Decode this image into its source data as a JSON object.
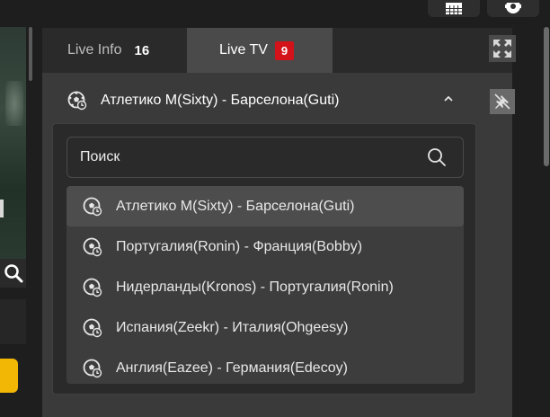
{
  "toolbar": {
    "calendar_icon": "calendar-grid-icon",
    "settings_icon": "gear-icon"
  },
  "tabs": {
    "live_info": {
      "label": "Live Info",
      "count": "16"
    },
    "live_tv": {
      "label": "Live TV",
      "count": "9"
    }
  },
  "current_match": {
    "title": "Атлетико М(Sixty) - Барселона(Guti)",
    "icon": "soccer-ball-icon"
  },
  "search": {
    "placeholder": "Поиск"
  },
  "matches": [
    {
      "label": "Атлетико М(Sixty) - Барселона(Guti)",
      "selected": true
    },
    {
      "label": "Португалия(Ronin) - Франция(Bobby)",
      "selected": false
    },
    {
      "label": "Нидерланды(Kronos) - Португалия(Ronin)",
      "selected": false
    },
    {
      "label": "Испания(Zeekr) - Италия(Ohgeesy)",
      "selected": false
    },
    {
      "label": "Англия(Eazee) - Германия(Edecoy)",
      "selected": false
    }
  ],
  "colors": {
    "badge_red": "#d4121a",
    "accent_yellow": "#f2b705"
  }
}
